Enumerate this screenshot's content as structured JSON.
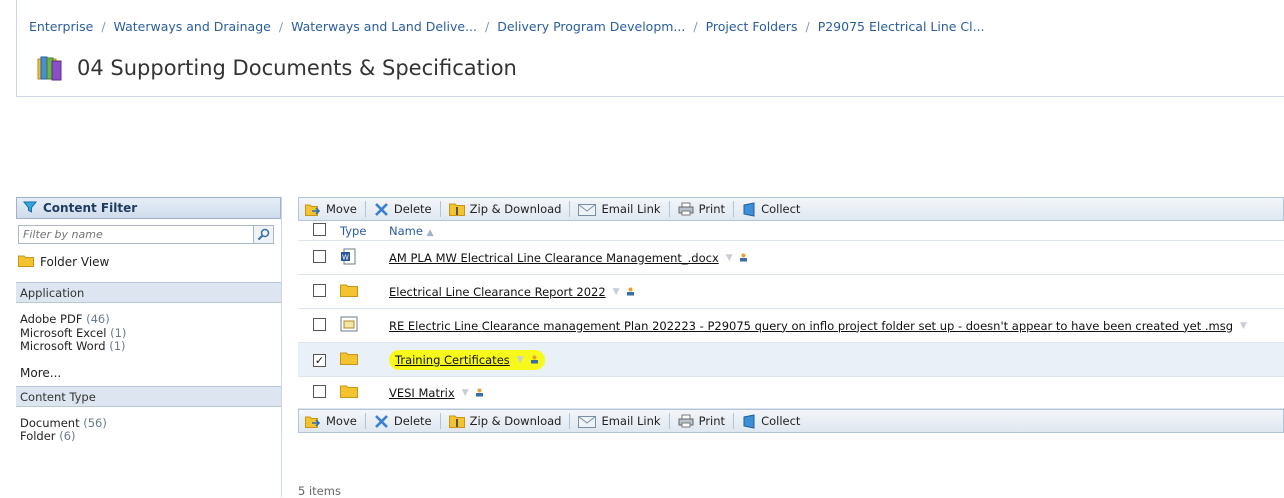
{
  "breadcrumb": [
    "Enterprise",
    "Waterways and Drainage",
    "Waterways and Land Delive...",
    "Delivery Program Developm...",
    "Project Folders",
    "P29075 Electrical Line Cl..."
  ],
  "breadcrumb_separator": "/",
  "page_title": "04 Supporting Documents & Specification",
  "content_filter": {
    "header": "Content Filter",
    "placeholder": "Filter by name",
    "folder_view": "Folder View",
    "application_header": "Application",
    "applications": [
      {
        "name": "Adobe PDF",
        "count": "(46)"
      },
      {
        "name": "Microsoft Excel",
        "count": "(1)"
      },
      {
        "name": "Microsoft Word",
        "count": "(1)"
      }
    ],
    "more": "More...",
    "content_type_header": "Content Type",
    "content_types": [
      {
        "name": "Document",
        "count": "(56)"
      },
      {
        "name": "Folder",
        "count": "(6)"
      }
    ]
  },
  "toolbar": {
    "move": "Move",
    "delete": "Delete",
    "zip": "Zip & Download",
    "email": "Email Link",
    "print": "Print",
    "collect": "Collect"
  },
  "columns": {
    "type": "Type",
    "name": "Name",
    "sort_indicator": "▲"
  },
  "items": [
    {
      "name": "AM PLA MW Electrical Line Clearance Management_.docx",
      "icon": "word-doc-icon",
      "checked": false
    },
    {
      "name": "Electrical Line Clearance Report 2022",
      "icon": "folder-icon",
      "checked": false
    },
    {
      "name": "RE Electric Line Clearance management Plan 202223 - P29075 query on inflo project folder set up - doesn't appear to have been created yet .msg",
      "icon": "email-msg-icon",
      "checked": false
    },
    {
      "name": "Training Certificates",
      "icon": "folder-icon",
      "checked": true,
      "highlighted": true
    },
    {
      "name": "VESI Matrix",
      "icon": "folder-icon",
      "checked": false
    }
  ],
  "check_mark": "✓",
  "caret": "▼",
  "item_count": "5 items",
  "colors": {
    "link": "#2a5d9e",
    "highlight": "#f7f91a",
    "folder": "#f4c430"
  }
}
